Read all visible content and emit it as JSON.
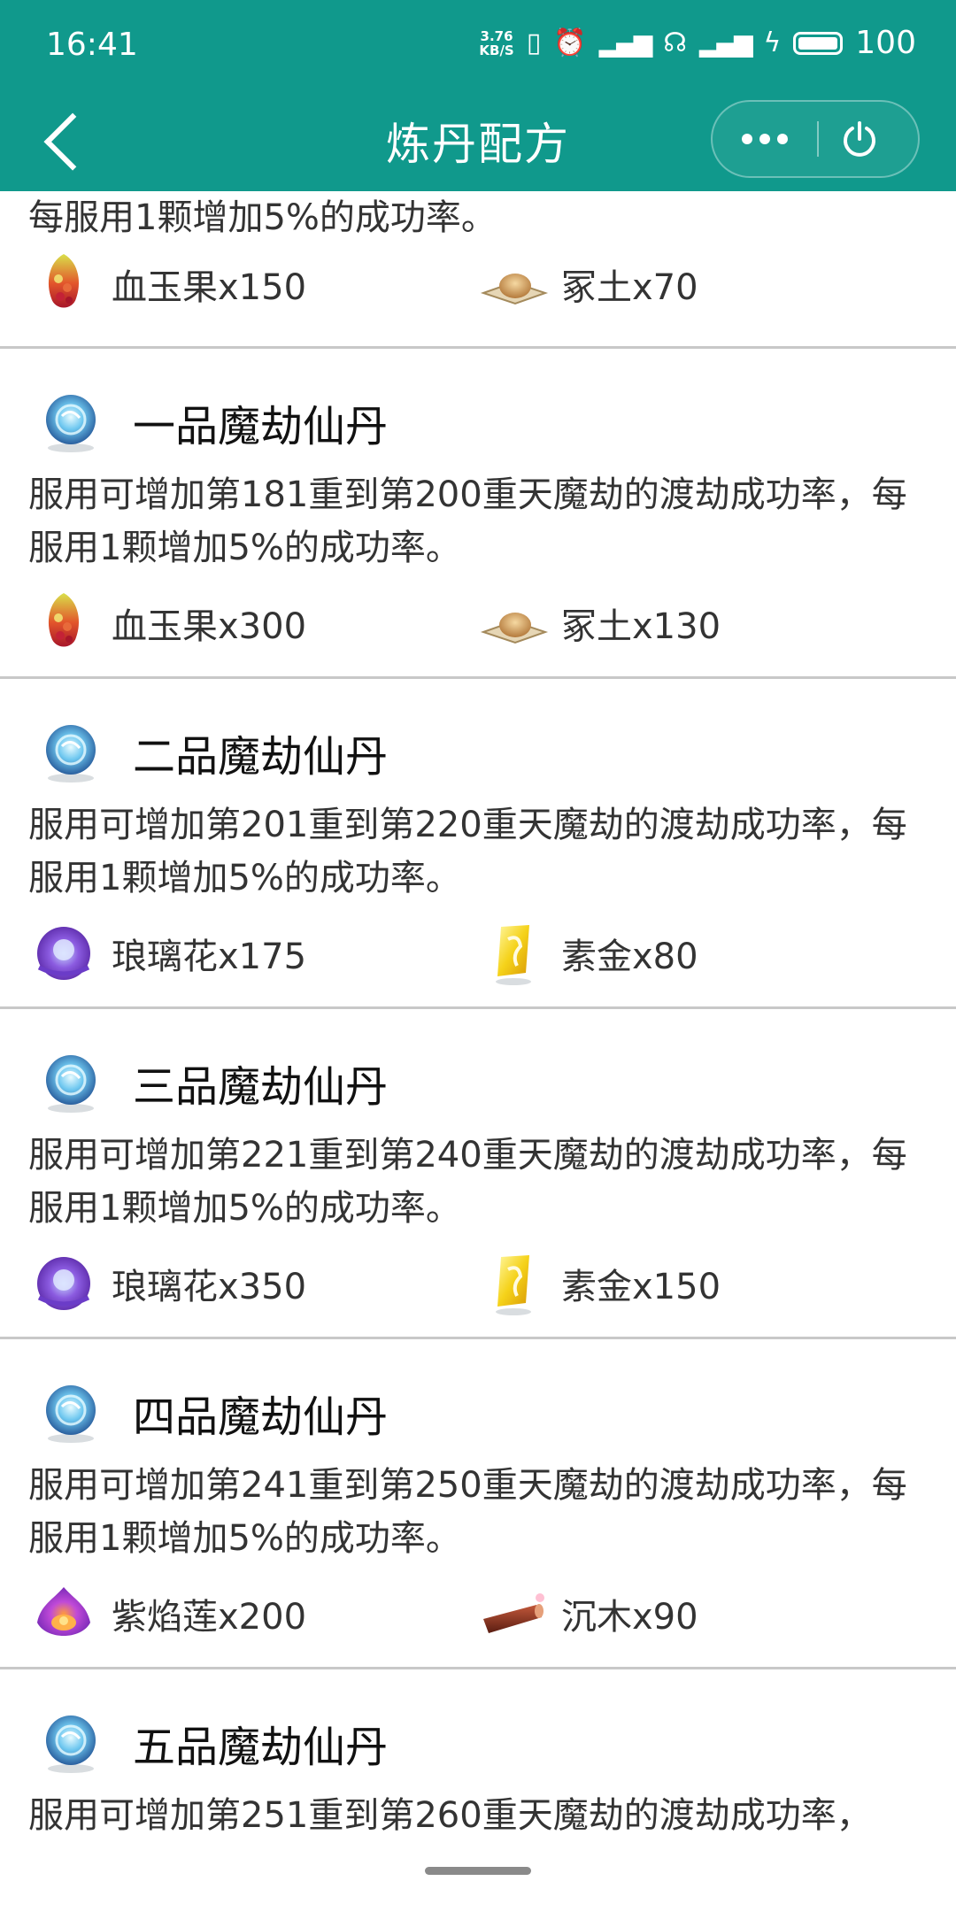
{
  "status_bar": {
    "time": "16:41",
    "net_speed_top": "3.76",
    "net_speed_unit": "KB/S",
    "battery": "100"
  },
  "nav": {
    "title": "炼丹配方"
  },
  "colors": {
    "header_bg": "#10998c"
  },
  "partial_top": {
    "desc_line2": "每服用1颗增加5%的成功率。",
    "materials": [
      {
        "icon": "blood-jade-fruit-icon",
        "label": "血玉果x150"
      },
      {
        "icon": "tomb-soil-icon",
        "label": "冢土x70"
      }
    ]
  },
  "recipes": [
    {
      "name": "一品魔劫仙丹",
      "desc": "服用可增加第181重到第200重天魔劫的渡劫成功率，每服用1颗增加5%的成功率。",
      "materials": [
        {
          "icon": "blood-jade-fruit-icon",
          "label": "血玉果x300"
        },
        {
          "icon": "tomb-soil-icon",
          "label": "冢土x130"
        }
      ]
    },
    {
      "name": "二品魔劫仙丹",
      "desc": "服用可增加第201重到第220重天魔劫的渡劫成功率，每服用1颗增加5%的成功率。",
      "materials": [
        {
          "icon": "langli-flower-icon",
          "label": "琅璃花x175"
        },
        {
          "icon": "plain-gold-icon",
          "label": "素金x80"
        }
      ]
    },
    {
      "name": "三品魔劫仙丹",
      "desc": "服用可增加第221重到第240重天魔劫的渡劫成功率，每服用1颗增加5%的成功率。",
      "materials": [
        {
          "icon": "langli-flower-icon",
          "label": "琅璃花x350"
        },
        {
          "icon": "plain-gold-icon",
          "label": "素金x150"
        }
      ]
    },
    {
      "name": "四品魔劫仙丹",
      "desc": "服用可增加第241重到第250重天魔劫的渡劫成功率，每服用1颗增加5%的成功率。",
      "materials": [
        {
          "icon": "purple-flame-lotus-icon",
          "label": "紫焰莲x200"
        },
        {
          "icon": "sunken-wood-icon",
          "label": "沉木x90"
        }
      ]
    },
    {
      "name": "五品魔劫仙丹",
      "desc": "服用可增加第251重到第260重天魔劫的渡劫成功率，",
      "materials": []
    }
  ]
}
